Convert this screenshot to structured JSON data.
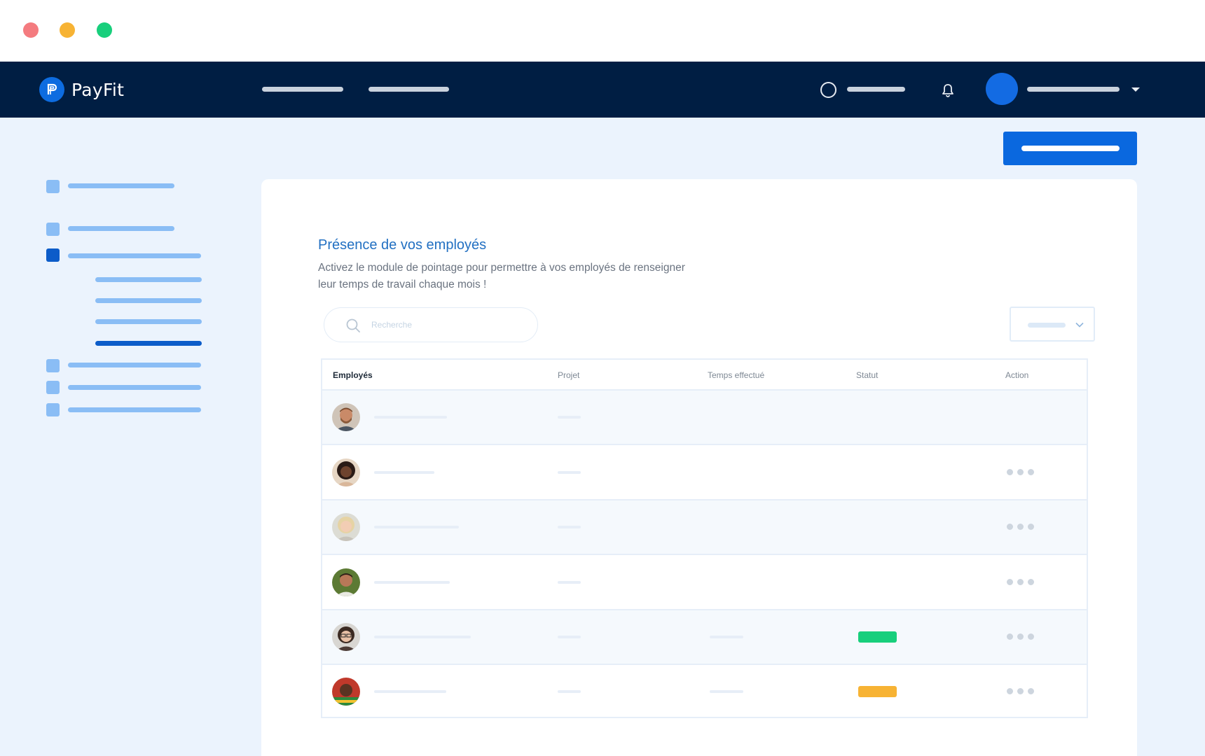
{
  "window": {
    "controls": [
      "close",
      "minimize",
      "maximize"
    ]
  },
  "navbar": {
    "brand": "PayFit",
    "icons": {
      "logo": "payfit-logo-icon",
      "help": "circle-icon",
      "notifications": "bell-icon",
      "account": "avatar",
      "menu": "caret-down-icon"
    }
  },
  "page": {
    "title": "Présence de vos employés",
    "subtitle_line1": "Activez le module de pointage pour permettre à vos employés de renseigner",
    "subtitle_line2": "leur temps de travail chaque mois !"
  },
  "search": {
    "placeholder": "Recherche",
    "icon": "search-icon"
  },
  "filter": {
    "icon": "chevron-down-icon"
  },
  "table": {
    "columns": [
      "Employés",
      "Projet",
      "Temps effectué",
      "Statut",
      "Action"
    ],
    "rows": [
      {
        "avatar": "employee-avatar-1",
        "status": null,
        "has_action": false
      },
      {
        "avatar": "employee-avatar-2",
        "status": null,
        "has_action": true
      },
      {
        "avatar": "employee-avatar-3",
        "status": null,
        "has_action": true
      },
      {
        "avatar": "employee-avatar-4",
        "status": null,
        "has_action": true
      },
      {
        "avatar": "employee-avatar-5",
        "status": "green",
        "has_action": true
      },
      {
        "avatar": "employee-avatar-6",
        "status": "yellow",
        "has_action": true
      }
    ]
  },
  "colors": {
    "navbar": "#001e43",
    "accent": "#0a68df",
    "title": "#2270c2",
    "status_green": "#18cf7c",
    "status_yellow": "#f7b334"
  }
}
